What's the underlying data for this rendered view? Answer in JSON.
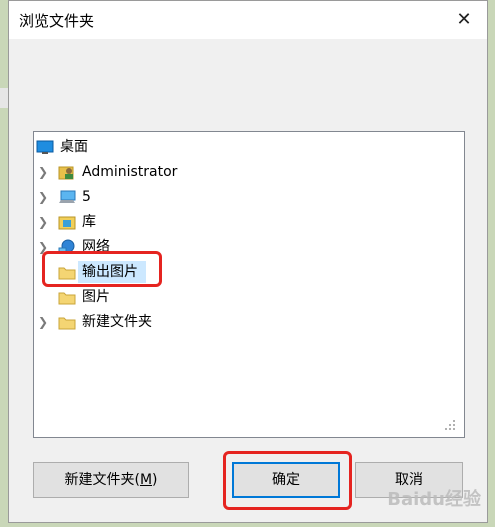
{
  "dialog": {
    "title": "浏览文件夹",
    "close_glyph": "✕"
  },
  "tree": {
    "root": {
      "label": "桌面",
      "icon": "desktop-icon"
    },
    "items": [
      {
        "label": "Administrator",
        "icon": "user-folder-icon",
        "expandable": true
      },
      {
        "label": "5",
        "icon": "computer-icon",
        "expandable": true
      },
      {
        "label": "库",
        "icon": "library-icon",
        "expandable": true
      },
      {
        "label": "网络",
        "icon": "network-icon",
        "expandable": true
      },
      {
        "label": "输出图片",
        "icon": "folder-icon",
        "expandable": false,
        "selected": true
      },
      {
        "label": "图片",
        "icon": "folder-icon",
        "expandable": false
      },
      {
        "label": "新建文件夹",
        "icon": "folder-icon",
        "expandable": true
      }
    ]
  },
  "buttons": {
    "new_folder": "新建文件夹(M)",
    "new_folder_prefix": "新建文件夹(",
    "new_folder_key": "M",
    "new_folder_suffix": ")",
    "ok": "确定",
    "cancel": "取消"
  },
  "watermark": "Baidu经验",
  "colors": {
    "highlight_box": "#e52420",
    "selection": "#cce8ff",
    "default_button_border": "#0078d7"
  }
}
